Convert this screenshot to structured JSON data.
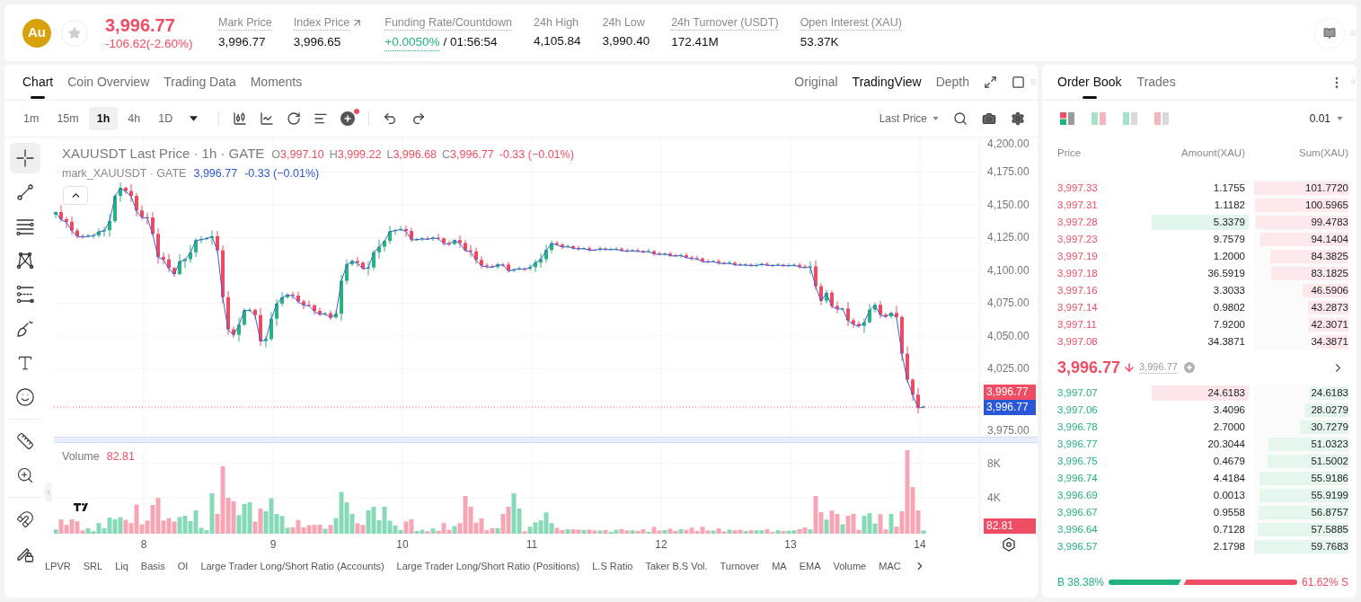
{
  "header": {
    "symbol_badge": "Au",
    "favorite": false,
    "falling": true,
    "last_price": "3,996.77",
    "change": "-106.62(-2.60%)",
    "stats": [
      {
        "kind": "plain",
        "label": "Mark Price",
        "value": "3,996.77",
        "underlined": true,
        "link": false
      },
      {
        "kind": "plain",
        "label": "Index Price",
        "value": "3,996.65",
        "underlined": true,
        "link": true
      },
      {
        "kind": "funding",
        "label": "Funding Rate/Countdown",
        "rate": "+0.0050%",
        "countdown": "/ 01:56:54",
        "underlined": true,
        "link": false
      },
      {
        "kind": "plain",
        "label": "24h High",
        "value": "4,105.84",
        "underlined": false,
        "link": false
      },
      {
        "kind": "plain",
        "label": "24h Low",
        "value": "3,990.40",
        "underlined": false,
        "link": false
      },
      {
        "kind": "plain",
        "label": "24h Turnover (USDT)",
        "value": "172.41M",
        "underlined": true,
        "link": false
      },
      {
        "kind": "plain",
        "label": "Open Interest (XAU)",
        "value": "53.37K",
        "underlined": true,
        "link": false
      }
    ]
  },
  "chart_panel": {
    "tabs": [
      {
        "label": "Chart",
        "selected": true
      },
      {
        "label": "Coin Overview",
        "selected": false
      },
      {
        "label": "Trading Data",
        "selected": false
      },
      {
        "label": "Moments",
        "selected": false
      }
    ],
    "views": [
      {
        "label": "Original",
        "selected": false
      },
      {
        "label": "TradingView",
        "selected": true
      },
      {
        "label": "Depth",
        "selected": false
      }
    ],
    "intervals": [
      {
        "label": "1m",
        "selected": false
      },
      {
        "label": "15m",
        "selected": false
      },
      {
        "label": "1h",
        "selected": true
      },
      {
        "label": "4h",
        "selected": false
      },
      {
        "label": "1D",
        "selected": false
      }
    ],
    "indicator_badge": true,
    "price_source": "Last Price",
    "drawing_tool_groups": [
      {
        "tools": [
          {
            "kind": "crosshair",
            "selected": true
          },
          {
            "kind": "trendline",
            "selected": false
          },
          {
            "kind": "hlines",
            "selected": false
          },
          {
            "kind": "pattern",
            "selected": false
          },
          {
            "kind": "fibonacci",
            "selected": false
          },
          {
            "kind": "brush",
            "selected": false
          },
          {
            "kind": "text",
            "selected": false
          },
          {
            "kind": "emoji",
            "selected": false
          }
        ]
      },
      {
        "tools": [
          {
            "kind": "ruler",
            "selected": false
          },
          {
            "kind": "zoom",
            "selected": false
          }
        ]
      },
      {
        "tools": [
          {
            "kind": "magnet",
            "selected": false
          },
          {
            "kind": "lock",
            "selected": false
          }
        ]
      }
    ],
    "legend": {
      "title": "XAUUSDT Last Price · 1h · GATE",
      "ohlc": [
        {
          "key": "O",
          "value": "3,997.10"
        },
        {
          "key": "H",
          "value": "3,999.22"
        },
        {
          "key": "L",
          "value": "3,996.68"
        },
        {
          "key": "C",
          "value": "3,996.77"
        }
      ],
      "change": "-0.33 (−0.01%)"
    },
    "mark_legend": {
      "title": "mark_XAUUSDT · GATE",
      "value": "3,996.77",
      "change": "-0.33 (−0.01%)"
    },
    "price_axis": [
      "4,200.00",
      "4,175.00",
      "4,150.00",
      "4,125.00",
      "4,100.00",
      "4,075.00",
      "4,050.00",
      "4,025.00",
      "3,975.00"
    ],
    "last_price_badge": "3,996.77",
    "mark_price_badge": "3,996.77",
    "volume": {
      "label": "Volume",
      "value": "82.81",
      "axis": [
        "8K",
        "4K"
      ],
      "badge": "82.81"
    },
    "time_axis": [
      "8",
      "9",
      "10",
      "11",
      "12",
      "13",
      "14"
    ],
    "indicators": [
      "LPVR",
      "SRL",
      "Liq",
      "Basis",
      "OI",
      "Large Trader Long/Short Ratio (Accounts)",
      "Large Trader Long/Short Ratio (Positions)",
      "L.S Ratio",
      "Taker B.S Vol.",
      "Turnover",
      "MA",
      "EMA",
      "Volume",
      "MAC"
    ]
  },
  "order_book": {
    "tabs": [
      {
        "label": "Order Book",
        "selected": true
      },
      {
        "label": "Trades",
        "selected": false
      }
    ],
    "layouts": [
      {
        "kind": "both",
        "selected": true
      },
      {
        "kind": "split",
        "selected": false
      },
      {
        "kind": "bids",
        "selected": false
      },
      {
        "kind": "asks",
        "selected": false
      }
    ],
    "precision": "0.01",
    "columns": [
      "Price",
      "Amount(XAU)",
      "Sum(XAU)"
    ],
    "asks": [
      {
        "price": "3,997.33",
        "amount": "1.1755",
        "sum": "101.7720",
        "level": 1
      },
      {
        "price": "3,997.31",
        "amount": "1.1182",
        "sum": "100.5965",
        "level": 0.99
      },
      {
        "price": "3,997.28",
        "amount": "5.3379",
        "sum": "99.4783",
        "level": 0.98,
        "color": "#e3f6ee"
      },
      {
        "price": "3,997.23",
        "amount": "9.7579",
        "sum": "94.1404",
        "level": 0.93
      },
      {
        "price": "3,997.19",
        "amount": "1.2000",
        "sum": "84.3825",
        "level": 0.83
      },
      {
        "price": "3,997.18",
        "amount": "36.5919",
        "sum": "83.1825",
        "level": 0.82
      },
      {
        "price": "3,997.16",
        "amount": "3.3033",
        "sum": "46.5906",
        "level": 0.49
      },
      {
        "price": "3,997.14",
        "amount": "0.9802",
        "sum": "43.2873",
        "level": 0.43
      },
      {
        "price": "3,997.11",
        "amount": "7.9200",
        "sum": "42.3071",
        "level": 0.42
      },
      {
        "price": "3,997.08",
        "amount": "34.3871",
        "sum": "34.3871",
        "level": 0.34
      }
    ],
    "mid": {
      "price": "3,996.77",
      "falling": true,
      "mark_price": "3,996.77"
    },
    "bids": [
      {
        "price": "3,997.07",
        "amount": "24.6183",
        "sum": "24.6183",
        "level": 0.41,
        "color": "#fde6ea"
      },
      {
        "price": "3,997.06",
        "amount": "3.4096",
        "sum": "28.0279",
        "level": 0.47
      },
      {
        "price": "3,996.78",
        "amount": "2.7000",
        "sum": "30.7279",
        "level": 0.51
      },
      {
        "price": "3,996.77",
        "amount": "20.3044",
        "sum": "51.0323",
        "level": 0.85
      },
      {
        "price": "3,996.75",
        "amount": "0.4679",
        "sum": "51.5002",
        "level": 0.86
      },
      {
        "price": "3,996.74",
        "amount": "4.4184",
        "sum": "55.9186",
        "level": 0.94
      },
      {
        "price": "3,996.69",
        "amount": "0.0013",
        "sum": "55.9199",
        "level": 0.94
      },
      {
        "price": "3,996.67",
        "amount": "0.9558",
        "sum": "56.8757",
        "level": 0.95
      },
      {
        "price": "3,996.64",
        "amount": "0.7128",
        "sum": "57.5885",
        "level": 0.96
      },
      {
        "price": "3,996.57",
        "amount": "2.1798",
        "sum": "59.7683",
        "level": 1
      }
    ],
    "ratio": {
      "buy": "B 38.38%",
      "sell": "61.62% S",
      "level": 0.3838
    }
  }
}
